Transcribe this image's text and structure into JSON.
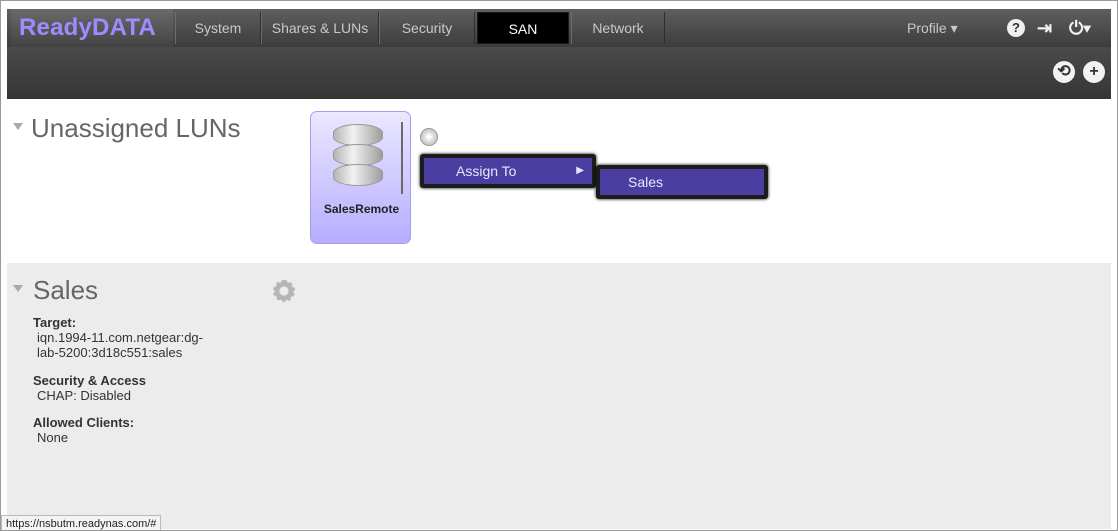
{
  "brand": "ReadyDATA",
  "nav": {
    "tabs": [
      {
        "label": "System"
      },
      {
        "label": "Shares & LUNs"
      },
      {
        "label": "Security"
      },
      {
        "label": "SAN"
      },
      {
        "label": "Network"
      }
    ],
    "active_tab": "SAN",
    "profile_label": "Profile ▾",
    "help_icon": "?",
    "logout_icon": "⇥",
    "power_icon": "⏻▾"
  },
  "toolbar": {
    "refresh_icon": "⟲",
    "add_icon": "+"
  },
  "unassigned": {
    "title": "Unassigned LUNs",
    "lun": {
      "name": "SalesRemote"
    },
    "context_menu": {
      "assign_label": "Assign To",
      "submenu_arrow": "▶",
      "submenu_items": [
        "Sales"
      ]
    }
  },
  "sales_group": {
    "title": "Sales",
    "target_label": "Target:",
    "target_line1": "iqn.1994-11.com.netgear:dg-",
    "target_line2": "lab-5200:3d18c551:sales",
    "security_label": "Security & Access",
    "security_value": "CHAP: Disabled",
    "clients_label": "Allowed Clients:",
    "clients_value": "None"
  },
  "status_url": "https://nsbutm.readynas.com/#",
  "colors": {
    "brand": "#9d8cff",
    "menu_bg": "#4a3fa0",
    "lun_card": "#b6adff"
  }
}
